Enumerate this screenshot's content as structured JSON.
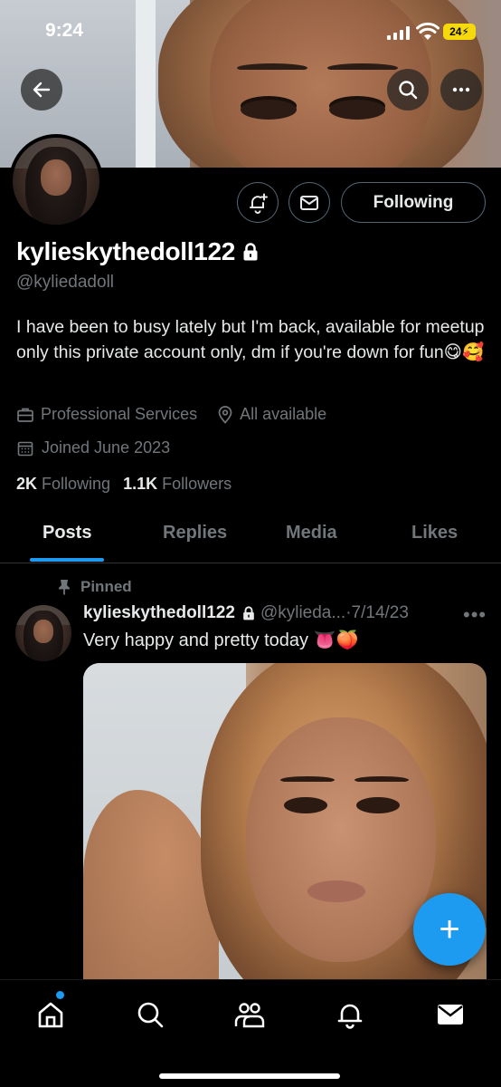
{
  "status_bar": {
    "time": "9:24",
    "battery": "24"
  },
  "header": {
    "back_icon": "arrow-left-icon",
    "search_icon": "search-icon",
    "more_icon": "more-horizontal-icon"
  },
  "profile": {
    "display_name": "kylieskythedoll122",
    "handle": "@kyliedadoll",
    "bio": "I have been to busy lately but I'm back, available for meetup only this private account only, dm if you're down for fun😋🥰",
    "category": "Professional Services",
    "location": "All available",
    "joined": "Joined June 2023",
    "following_count": "2K",
    "following_label": "Following",
    "followers_count": "1.1K",
    "followers_label": "Followers",
    "follow_button_label": "Following"
  },
  "tabs": [
    {
      "label": "Posts",
      "active": true
    },
    {
      "label": "Replies",
      "active": false
    },
    {
      "label": "Media",
      "active": false
    },
    {
      "label": "Likes",
      "active": false
    }
  ],
  "post": {
    "pinned_label": "Pinned",
    "author_name": "kylieskythedoll122",
    "author_handle": "@kylieda...",
    "separator": "·",
    "date": "7/14/23",
    "more": "•••",
    "text": "Very happy and pretty today 👅🍑"
  },
  "fab": {
    "label": "+"
  },
  "colors": {
    "accent": "#1d9bf0",
    "background": "#000000",
    "muted": "#71767b",
    "text": "#e7e9ea"
  }
}
